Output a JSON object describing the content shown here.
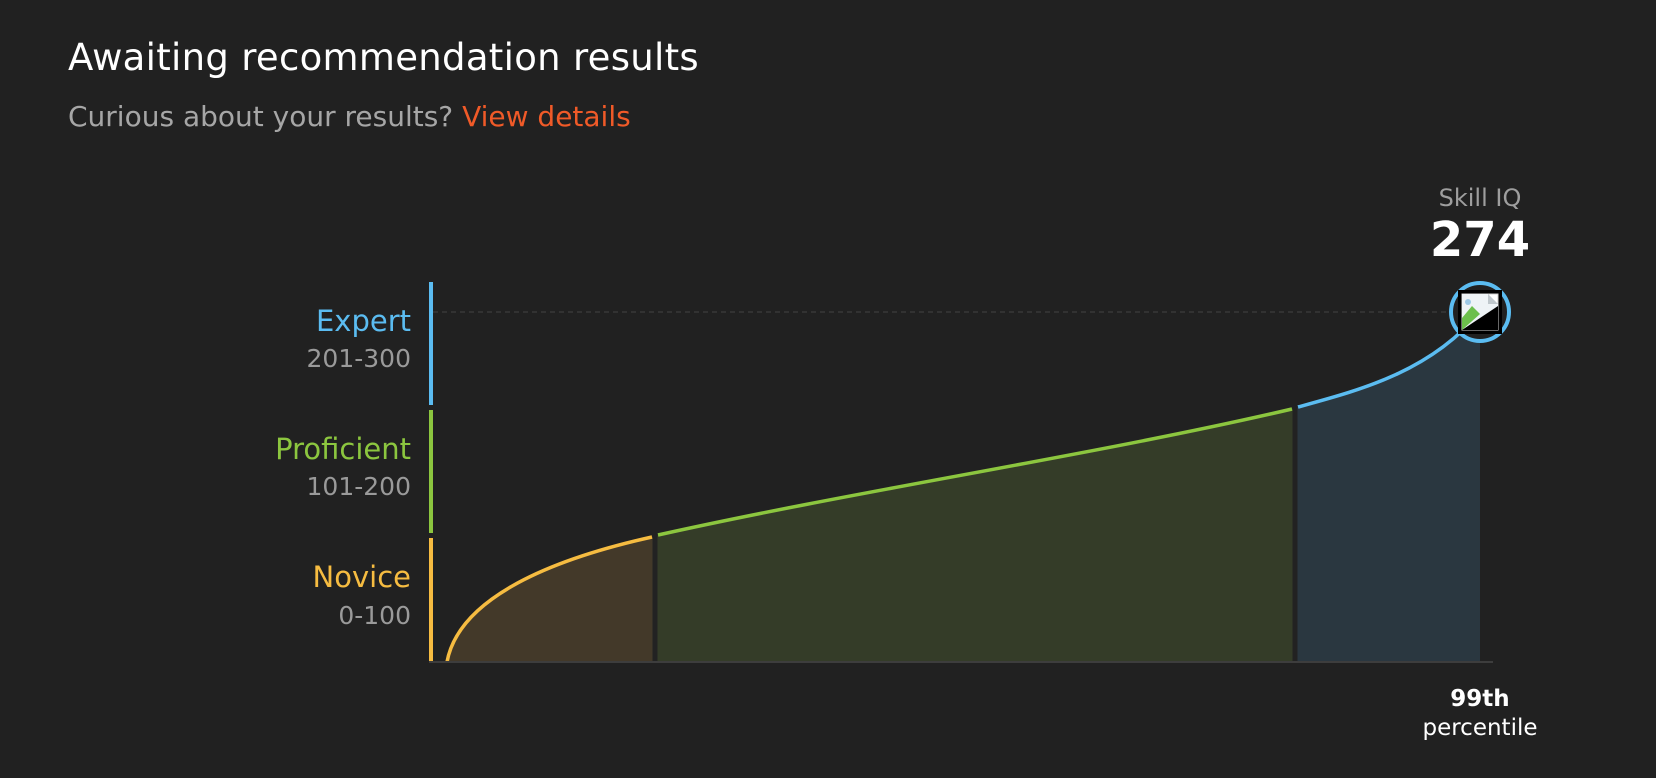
{
  "header": {
    "title": "Awaiting recommendation results",
    "subtitle_prefix": "Curious about your results?",
    "details_link": "View details"
  },
  "skill_iq": {
    "label": "Skill IQ",
    "score": "274",
    "percentile_value": "99th",
    "percentile_label": "percentile",
    "avatar_icon": "broken-image-icon"
  },
  "levels": [
    {
      "name": "Expert",
      "range": "201-300",
      "color": "#5bbcf1"
    },
    {
      "name": "Proficient",
      "range": "101-200",
      "color": "#8cc63f"
    },
    {
      "name": "Novice",
      "range": "0-100",
      "color": "#f6bc41"
    }
  ],
  "colors": {
    "background": "#212121",
    "accent": "#f05a28",
    "novice_fill": "#433929",
    "proficient_fill": "#343c28",
    "expert_fill": "#2a3740"
  }
}
